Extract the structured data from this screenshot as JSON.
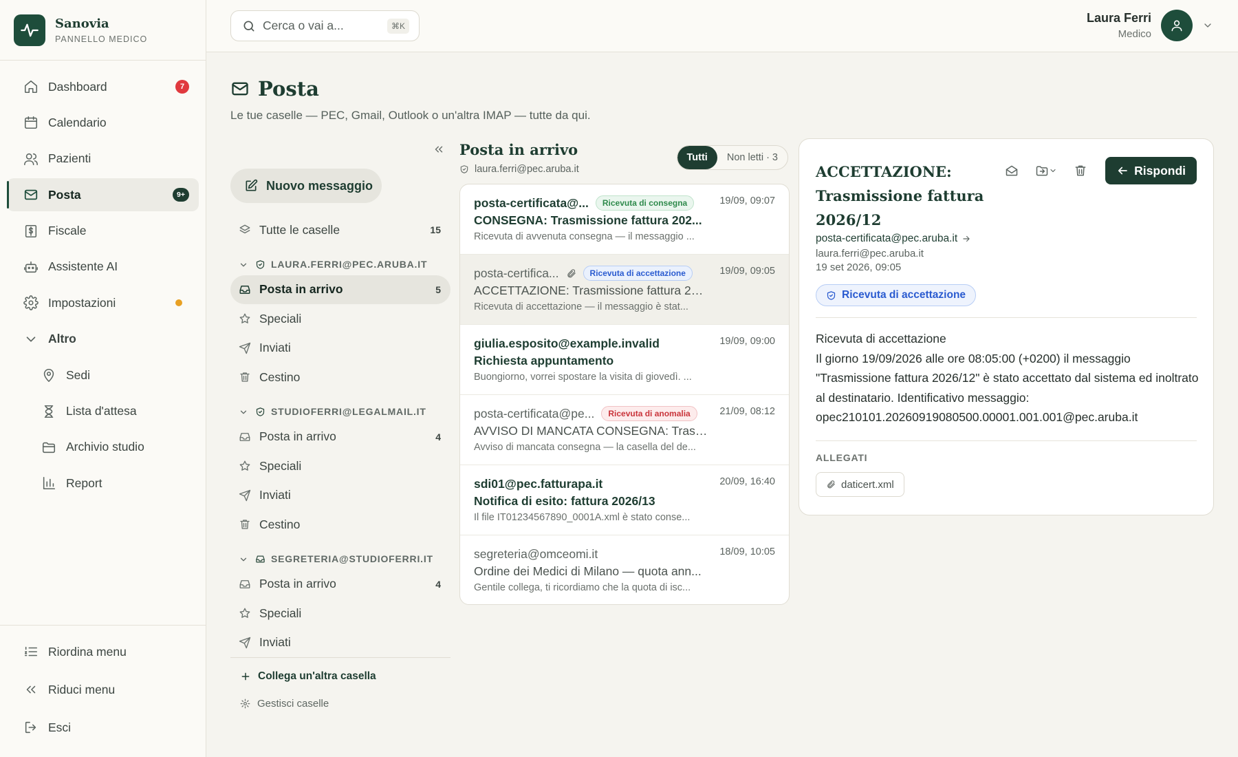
{
  "brand": {
    "name": "Sanovia",
    "subtitle": "PANNELLO MEDICO"
  },
  "sidebar": {
    "items": [
      {
        "label": "Dashboard",
        "icon": "home-icon",
        "badge": "7"
      },
      {
        "label": "Calendario",
        "icon": "calendar-icon"
      },
      {
        "label": "Pazienti",
        "icon": "users-icon"
      },
      {
        "label": "Posta",
        "icon": "mail-icon",
        "badge": "9+",
        "active": true
      },
      {
        "label": "Fiscale",
        "icon": "receipt-icon"
      },
      {
        "label": "Assistente AI",
        "icon": "bot-icon"
      },
      {
        "label": "Impostazioni",
        "icon": "gear-icon",
        "dot": true
      }
    ],
    "group": {
      "label": "Altro",
      "expanded": true
    },
    "sub_items": [
      {
        "label": "Sedi",
        "icon": "map-pin-icon"
      },
      {
        "label": "Lista d'attesa",
        "icon": "hourglass-icon"
      },
      {
        "label": "Archivio studio",
        "icon": "folder-icon"
      },
      {
        "label": "Report",
        "icon": "bar-chart-icon"
      }
    ],
    "bottom": {
      "reorder": "Riordina menu",
      "collapse": "Riduci menu",
      "logout": "Esci"
    }
  },
  "topbar": {
    "search_placeholder": "Cerca o vai a...",
    "shortcut": "⌘K",
    "user_name": "Laura Ferri",
    "user_role": "Medico"
  },
  "page": {
    "title": "Posta",
    "subtitle": "Le tue caselle — PEC, Gmail, Outlook o un'altra IMAP — tutte da qui."
  },
  "mailboxes": {
    "new_message": "Nuovo messaggio",
    "all_label": "Tutte le caselle",
    "all_count": "15",
    "accounts": [
      {
        "address": "LAURA.FERRI@PEC.ARUBA.IT",
        "folders": [
          {
            "label": "Posta in arrivo",
            "count": "5",
            "active": true
          },
          {
            "label": "Speciali"
          },
          {
            "label": "Inviati"
          },
          {
            "label": "Cestino"
          }
        ]
      },
      {
        "address": "STUDIOFERRI@LEGALMAIL.IT",
        "folders": [
          {
            "label": "Posta in arrivo",
            "count": "4"
          },
          {
            "label": "Speciali"
          },
          {
            "label": "Inviati"
          },
          {
            "label": "Cestino"
          }
        ]
      },
      {
        "address": "SEGRETERIA@STUDIOFERRI.IT",
        "folders": [
          {
            "label": "Posta in arrivo",
            "count": "4"
          },
          {
            "label": "Speciali"
          },
          {
            "label": "Inviati"
          }
        ]
      }
    ],
    "add_account": "Collega un'altra casella",
    "manage": "Gestisci caselle"
  },
  "list": {
    "title": "Posta in arrivo",
    "address": "laura.ferri@pec.aruba.it",
    "filter_all": "Tutti",
    "filter_unread": "Non letti · 3",
    "messages": [
      {
        "from": "posta-certificata@...",
        "tag": "Ricevuta di consegna",
        "tag_color": "#2f8a4c",
        "time": "19/09, 09:07",
        "subject": "CONSEGNA: Trasmissione fattura 202...",
        "preview": "Ricevuta di avvenuta consegna — il messaggio ...",
        "unread": true
      },
      {
        "from": "posta-certifica...",
        "attachment": true,
        "tag": "Ricevuta di accettazione",
        "tag_color": "#2a5bd0",
        "time": "19/09, 09:05",
        "subject": "ACCETTAZIONE: Trasmissione fattura 20...",
        "preview": "Ricevuta di accettazione — il messaggio è stat...",
        "selected": true
      },
      {
        "from": "giulia.esposito@example.invalid",
        "time": "19/09, 09:00",
        "subject": "Richiesta appuntamento",
        "preview": "Buongiorno, vorrei spostare la visita di giovedì. ...",
        "unread": true
      },
      {
        "from": "posta-certificata@pe...",
        "tag": "Ricevuta di anomalia",
        "tag_color": "#c9343a",
        "time": "21/09, 08:12",
        "subject": "AVVISO DI MANCATA CONSEGNA: Trasmi...",
        "preview": "Avviso di mancata consegna — la casella del de..."
      },
      {
        "from": "sdi01@pec.fatturapa.it",
        "time": "20/09, 16:40",
        "subject": "Notifica di esito: fattura 2026/13",
        "preview": "Il file IT01234567890_0001A.xml è stato conse...",
        "unread": true
      },
      {
        "from": "segreteria@omceomi.it",
        "time": "18/09, 10:05",
        "subject": "Ordine dei Medici di Milano — quota ann...",
        "preview": "Gentile collega, ti ricordiamo che la quota di isc..."
      }
    ]
  },
  "reader": {
    "subject": "ACCETTAZIONE: Trasmissione fattura 2026/12",
    "from": "posta-certificata@pec.aruba.it",
    "to": "laura.ferri@pec.aruba.it",
    "date": "19 set 2026, 09:05",
    "tag": "Ricevuta di accettazione",
    "reply": "Rispondi",
    "body": "Ricevuta di accettazione\nIl giorno 19/09/2026 alle ore 08:05:00 (+0200) il messaggio \"Trasmissione fattura 2026/12\" è stato accettato dal sistema ed inoltrato al destinatario. Identificativo messaggio: opec210101.20260919080500.00001.001.001@pec.aruba.it",
    "attachments_label": "ALLEGATI",
    "attachment": "daticert.xml"
  },
  "colors": {
    "brand": "#1e4d3b",
    "accent_dark": "#1e3d31",
    "badge_red": "#e0393e",
    "dot_orange": "#e8a023"
  }
}
